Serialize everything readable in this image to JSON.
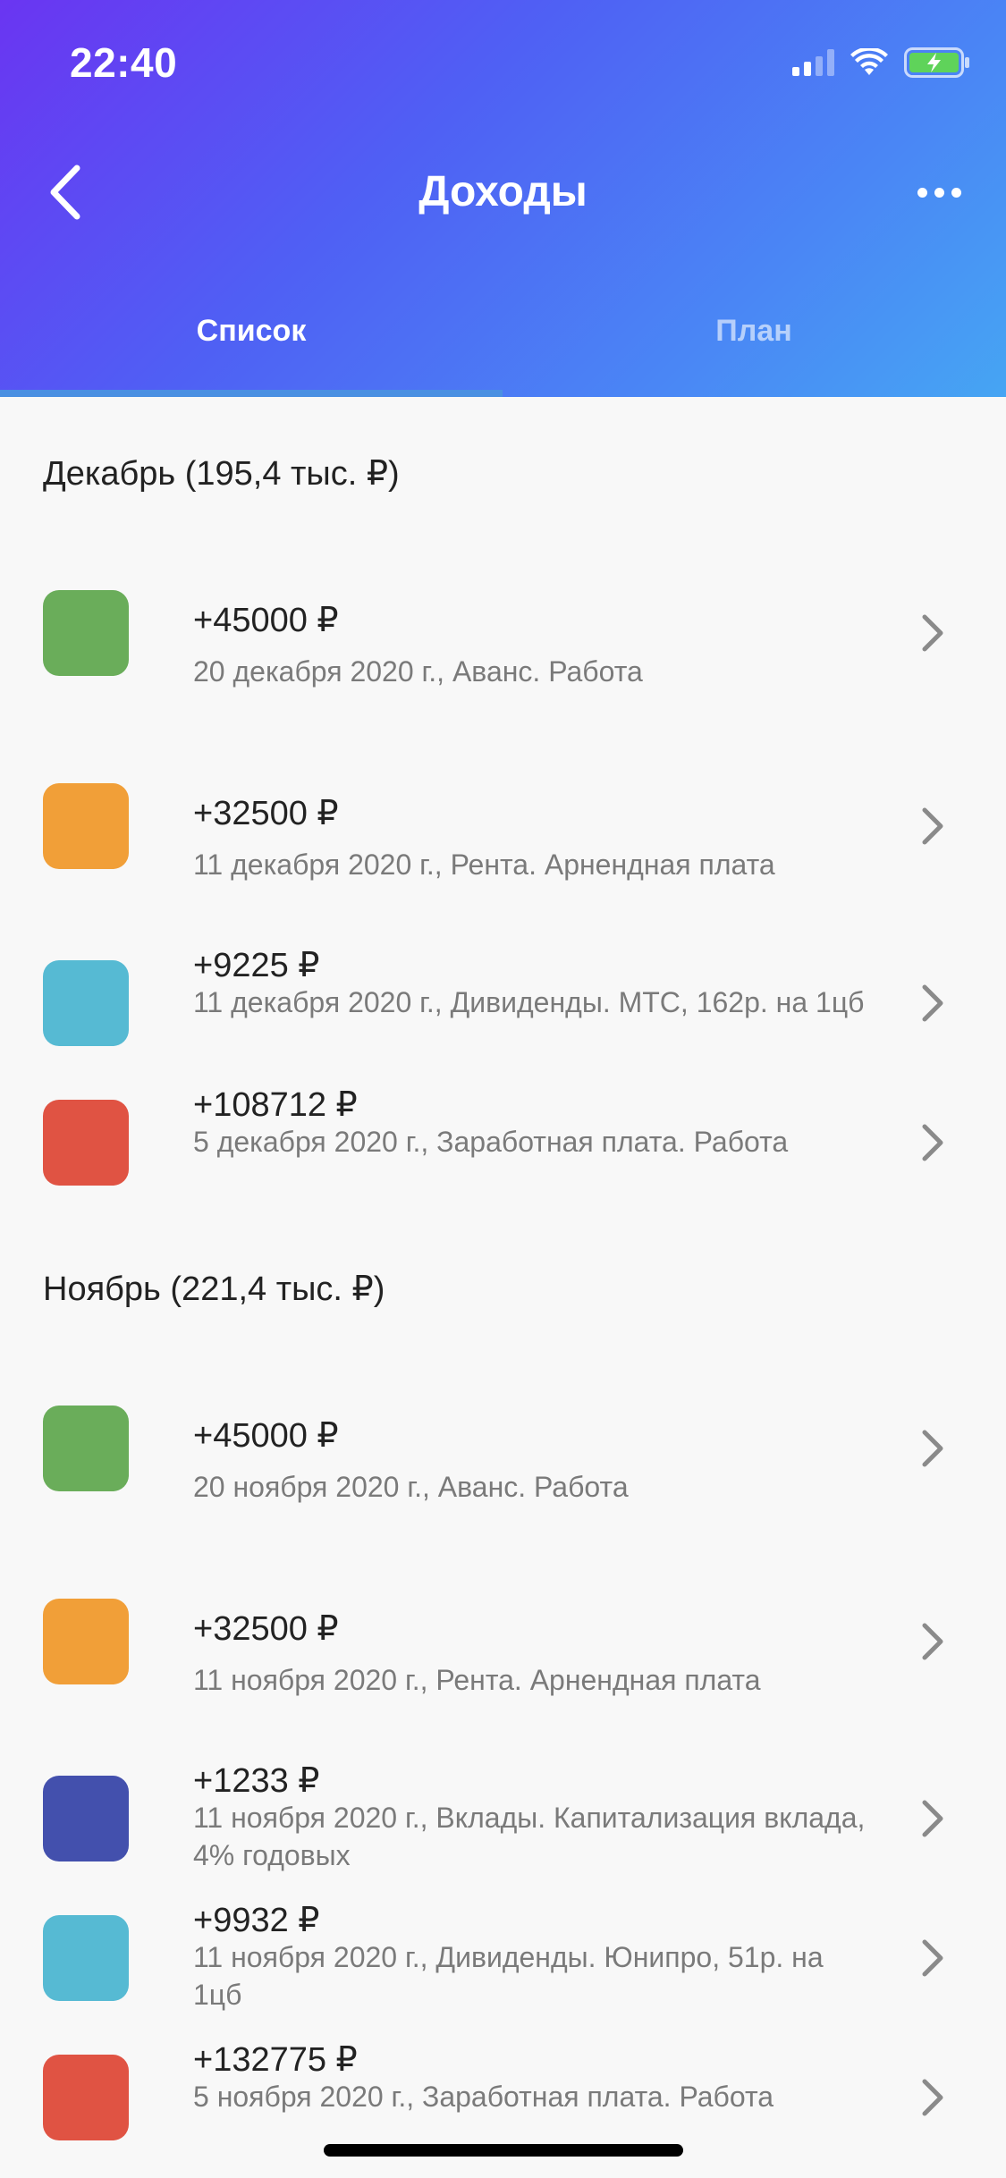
{
  "status_bar": {
    "time": "22:40"
  },
  "header": {
    "title": "Доходы"
  },
  "tabs": [
    {
      "label": "Список",
      "active": true
    },
    {
      "label": "План",
      "active": false
    }
  ],
  "sections": [
    {
      "title": "Декабрь (195,4 тыс. ₽)",
      "items": [
        {
          "amount": "+45000 ₽",
          "description": "20 декабря 2020 г., Аванс. Работа",
          "color": "#6aad5a"
        },
        {
          "amount": "+32500 ₽",
          "description": "11 декабря 2020 г., Рента. Арнендная плата",
          "color": "#f19f38"
        },
        {
          "amount": "+9225 ₽",
          "description": "11 декабря 2020 г., Дивиденды. МТС, 162р. на 1цб",
          "color": "#56bad3"
        },
        {
          "amount": "+108712 ₽",
          "description": "5 декабря 2020 г., Заработная плата. Работа",
          "color": "#e05343"
        }
      ]
    },
    {
      "title": "Ноябрь (221,4 тыс. ₽)",
      "items": [
        {
          "amount": "+45000 ₽",
          "description": "20 ноября 2020 г., Аванс. Работа",
          "color": "#6aad5a"
        },
        {
          "amount": "+32500 ₽",
          "description": "11 ноября 2020 г., Рента. Арнендная плата",
          "color": "#f19f38"
        },
        {
          "amount": "+1233 ₽",
          "description": "11 ноября 2020 г., Вклады. Капитализация вклада, 4% годовых",
          "color": "#4350ad"
        },
        {
          "amount": "+9932 ₽",
          "description": "11 ноября 2020 г., Дивиденды. Юнипро, 51р. на 1цб",
          "color": "#56bad3"
        },
        {
          "amount": "+132775 ₽",
          "description": "5 ноября 2020 г., Заработная плата. Работа",
          "color": "#e05343"
        }
      ]
    }
  ],
  "icons": {
    "back": "chevron-left-icon",
    "more": "more-horizontal-icon",
    "row_chevron": "chevron-right-icon",
    "signal": "cellular-signal-icon",
    "wifi": "wifi-icon",
    "battery": "battery-charging-icon"
  }
}
